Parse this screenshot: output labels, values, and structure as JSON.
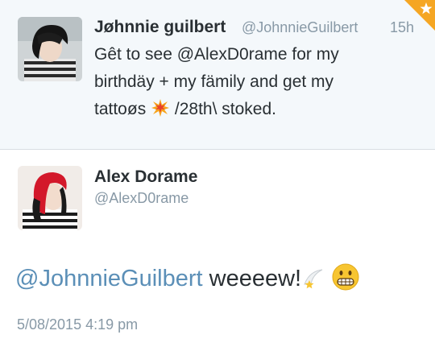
{
  "original_tweet": {
    "display_name": "Jøhnnie guilbert",
    "handle": "@JohnnieGuilbert",
    "time_ago": "15h",
    "text_line_1": "Gêt to see @AlexD0rame for my",
    "text_line_2": "birthdäy + my fämily and get my",
    "text_line_3a": "tattoøs",
    "text_line_3b": "/28th\\ stoked.",
    "text_emoji": "collision-icon",
    "favorited": true,
    "colors": {
      "background": "#f4f8fb",
      "favorite_star": "#f5a623"
    }
  },
  "reply_tweet": {
    "display_name": "Alex Dorame",
    "handle": "@AlexD0rame",
    "mention": "@JohnnieGuilbert",
    "message": "weeeew!",
    "emojis": [
      "dizzy-icon",
      "grimacing-face-icon"
    ],
    "timestamp": "5/08/2015 4:19 pm",
    "colors": {
      "mention": "#5b8fb7"
    }
  }
}
